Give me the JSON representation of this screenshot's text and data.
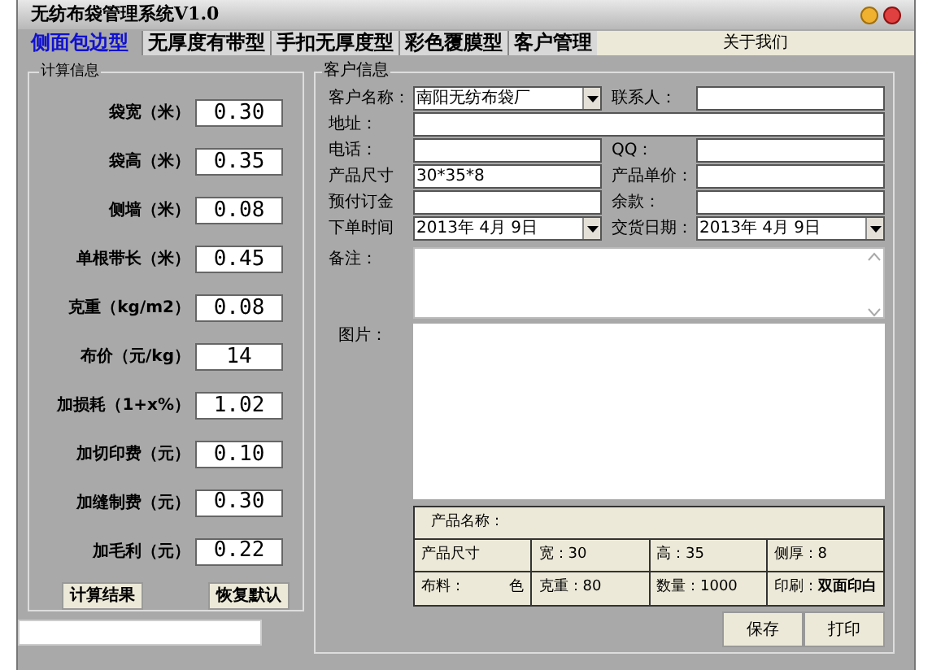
{
  "window": {
    "title": "无纺布袋管理系统V1.0"
  },
  "tabs": [
    {
      "label": "侧面包边型",
      "selected": true
    },
    {
      "label": "无厚度有带型",
      "selected": false
    },
    {
      "label": "手扣无厚度型",
      "selected": false
    },
    {
      "label": "彩色覆膜型",
      "selected": false
    },
    {
      "label": "客户管理",
      "selected": false
    },
    {
      "label": "关于我们",
      "selected": false
    }
  ],
  "calc": {
    "title": "计算信息",
    "fields": [
      {
        "label": "袋宽（米）",
        "value": "0.30"
      },
      {
        "label": "袋高（米）",
        "value": "0.35"
      },
      {
        "label": "侧墙（米）",
        "value": "0.08"
      },
      {
        "label": "单根带长（米）",
        "value": "0.45"
      },
      {
        "label": "克重（kg/m2）",
        "value": "0.08"
      },
      {
        "label": "布价（元/kg）",
        "value": "14"
      },
      {
        "label": "加损耗（1+x%）",
        "value": "1.02"
      },
      {
        "label": "加切印费（元）",
        "value": "0.10"
      },
      {
        "label": "加缝制费（元）",
        "value": "0.30"
      },
      {
        "label": "加毛利（元）",
        "value": "0.22"
      }
    ],
    "buttons": [
      "计算结果",
      "恢复默认"
    ]
  },
  "customer": {
    "title": "客户信息",
    "rows": [
      [
        {
          "label": "客户名称：",
          "value": "南阳无纺布袋厂",
          "kind": "combo"
        },
        {
          "label": "联系人：",
          "kind": "input"
        }
      ],
      [
        {
          "label": "地址：",
          "kind": "input"
        }
      ],
      [
        {
          "label": "电话：",
          "kind": "input"
        },
        {
          "label": "QQ：",
          "kind": "input"
        }
      ],
      [
        {
          "label": "产品尺寸",
          "value": "30*35*8",
          "kind": "input"
        },
        {
          "label": "产品单价：",
          "kind": "input"
        }
      ],
      [
        {
          "label": "预付订金",
          "kind": "input"
        },
        {
          "label": "余款：",
          "kind": "input"
        }
      ],
      [
        {
          "label": "下单时间",
          "value": "2013年 4月 9日",
          "kind": "combo"
        },
        {
          "label": "交货日期：",
          "value": "2013年 4月 9日",
          "kind": "combo"
        }
      ]
    ],
    "remarks_label": "备注：",
    "picture_label": "图片：",
    "summary": {
      "name_label": "产品名称：",
      "rows": [
        [
          "产品尺寸",
          "宽：30",
          "高：35",
          "侧厚：8"
        ],
        [
          "布料：　　　色",
          "克重：80",
          "数量：1000",
          "印刷：**双面印白**"
        ]
      ]
    },
    "buttons": [
      "保存",
      "打印"
    ]
  }
}
